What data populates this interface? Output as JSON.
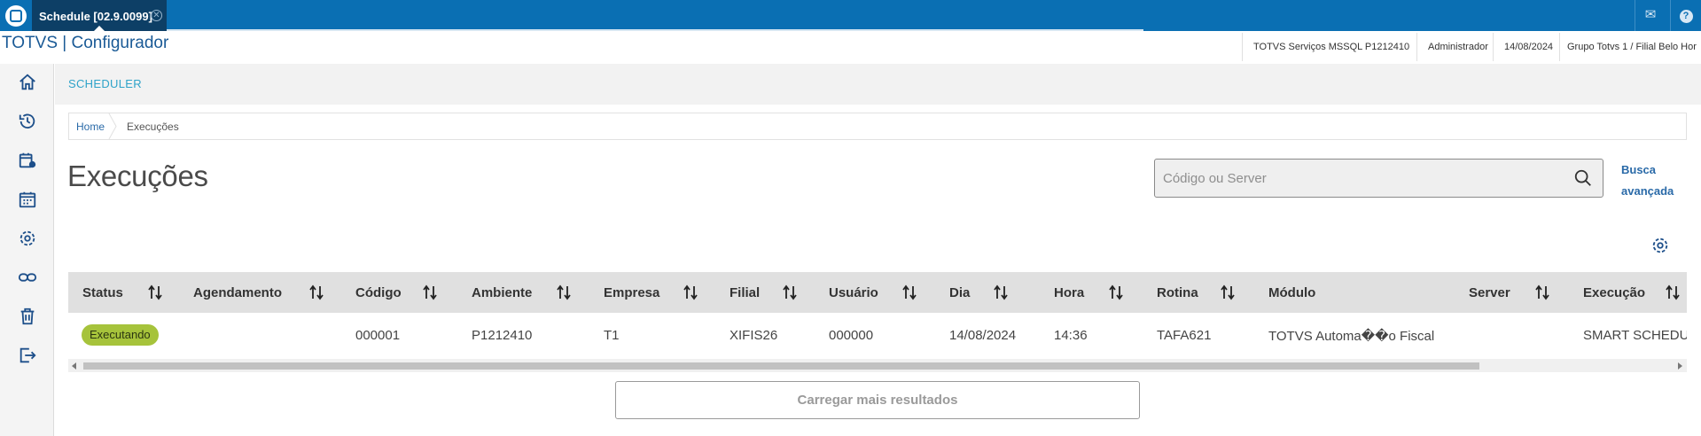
{
  "window": {
    "tab_title": "Schedule [02.9.0099]",
    "tab_close": "✕",
    "mail_glyph": "✉",
    "help_glyph": "?"
  },
  "header": {
    "app_title": "TOTVS | Configurador",
    "info": [
      "TOTVS Serviços MSSQL P1212410",
      "Administrador",
      "14/08/2024",
      "Grupo Totvs 1 / Filial Belo Hor"
    ]
  },
  "sidebar": {
    "items": [
      "home-icon",
      "history-icon",
      "calendar-settings-icon",
      "calendar-icon",
      "gear-icon",
      "link-icon",
      "trash-icon",
      "logout-icon"
    ]
  },
  "section": {
    "title": "SCHEDULER"
  },
  "breadcrumb": {
    "home": "Home",
    "current": "Execuções"
  },
  "page": {
    "title": "Execuções"
  },
  "search": {
    "placeholder": "Código ou Server",
    "advanced_label_1": "Busca",
    "advanced_label_2": "avançada"
  },
  "table": {
    "columns": [
      "Status",
      "Agendamento",
      "Código",
      "Ambiente",
      "Empresa",
      "Filial",
      "Usuário",
      "Dia",
      "Hora",
      "Rotina",
      "Módulo",
      "Server",
      "Execução"
    ],
    "rows": [
      {
        "status": "Executando",
        "agendamento": "",
        "codigo": "000001",
        "ambiente": "P1212410",
        "empresa": "T1",
        "filial": "XIFIS26",
        "usuario": "000000",
        "dia": "14/08/2024",
        "hora": "14:36",
        "rotina": "TAFA621",
        "modulo": "TOTVS Automa��o Fiscal",
        "server": "",
        "execucao": "SMART SCHEDULER"
      }
    ]
  },
  "actions": {
    "load_more": "Carregar mais resultados"
  },
  "colors": {
    "topbar": "#0a6fb3",
    "tab_active": "#0d3f66",
    "brand_title": "#1a5a96",
    "section_title": "#2fa3c9",
    "status_running": "#a6c33b",
    "link": "#2a6aa8"
  }
}
